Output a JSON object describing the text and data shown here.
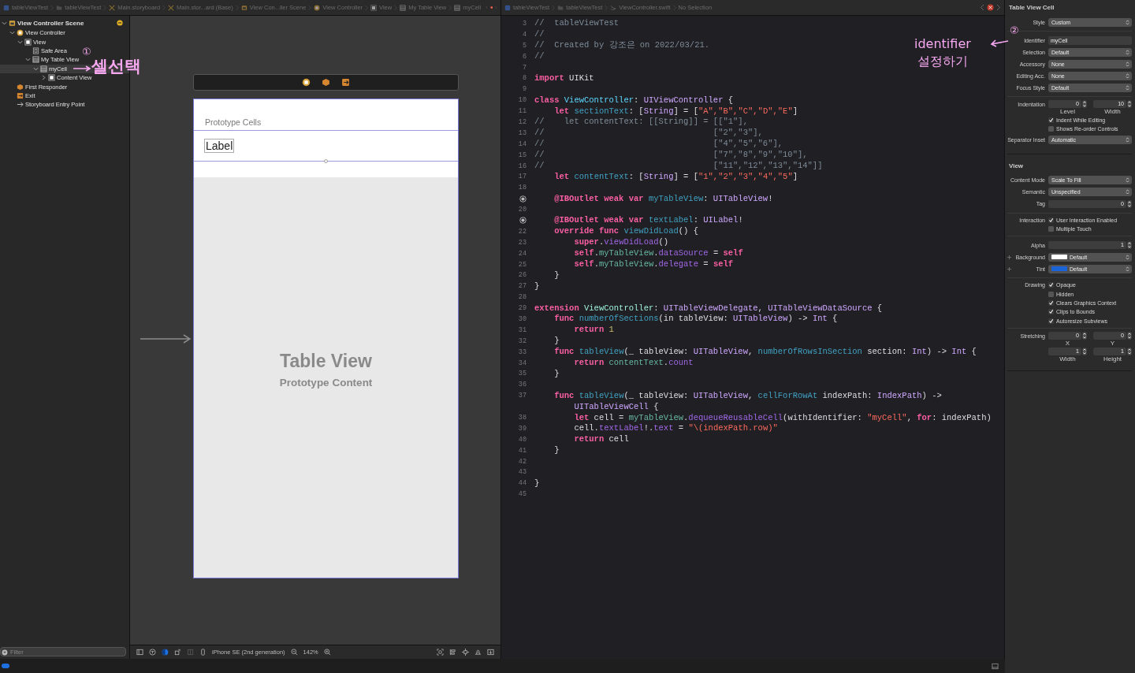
{
  "breadcrumbs_left": [
    {
      "kind": "project",
      "text": "tableViewTest"
    },
    {
      "kind": "folder",
      "text": "tableViewTest"
    },
    {
      "kind": "storyboard",
      "text": "Main.storyboard"
    },
    {
      "kind": "storyboard",
      "text": "Main.stor...ard (Base)"
    },
    {
      "kind": "scene",
      "text": "View Con...ller Scene"
    },
    {
      "kind": "vc",
      "text": "View Controller"
    },
    {
      "kind": "view",
      "text": "View"
    },
    {
      "kind": "table",
      "text": "My Table View"
    },
    {
      "kind": "table",
      "text": "myCell"
    }
  ],
  "breadcrumbs_right": [
    {
      "kind": "project",
      "text": "tableViewTest"
    },
    {
      "kind": "folder",
      "text": "tableViewTest"
    },
    {
      "kind": "swift",
      "text": "ViewController.swift"
    },
    {
      "kind": "none",
      "text": "No Selection"
    }
  ],
  "outline": {
    "items": [
      {
        "kind": "scene",
        "label": "View Controller Scene",
        "expanded": true,
        "selected": false,
        "children": [
          {
            "kind": "vc",
            "label": "View Controller",
            "expanded": true,
            "selected": false,
            "children": [
              {
                "kind": "view",
                "label": "View",
                "expanded": true,
                "selected": false,
                "children": [
                  {
                    "kind": "safearea",
                    "label": "Safe Area",
                    "selected": false
                  },
                  {
                    "kind": "table",
                    "label": "My Table View",
                    "expanded": true,
                    "selected": false,
                    "children": [
                      {
                        "kind": "table",
                        "label": "myCell",
                        "expanded": true,
                        "selected": true,
                        "children": [
                          {
                            "kind": "view",
                            "label": "Content View",
                            "expanded": false,
                            "selected": false
                          }
                        ]
                      }
                    ]
                  }
                ]
              }
            ]
          },
          {
            "kind": "responder",
            "label": "First Responder",
            "selected": false
          },
          {
            "kind": "exit",
            "label": "Exit",
            "selected": false
          },
          {
            "kind": "entry",
            "label": "Storyboard Entry Point",
            "selected": false
          }
        ]
      }
    ]
  },
  "filter": {
    "placeholder": "Filter"
  },
  "canvas": {
    "prototype_header": "Prototype Cells",
    "cell_label": "Label",
    "table_title": "Table View",
    "table_subtitle": "Prototype Content"
  },
  "canvas_toolbar": {
    "device": "iPhone SE (2nd generation)",
    "zoom": "142%"
  },
  "editor": {
    "lines": [
      {
        "kind": "line",
        "number": "3",
        "parts": [
          {
            "kind": "cmt",
            "text": "//  tableViewTest"
          }
        ]
      },
      {
        "kind": "line",
        "number": "4",
        "parts": [
          {
            "kind": "cmt",
            "text": "//"
          }
        ]
      },
      {
        "kind": "line",
        "number": "5",
        "parts": [
          {
            "kind": "cmt",
            "text": "//  Created by 강조은 on 2022/03/21."
          }
        ]
      },
      {
        "kind": "line",
        "number": "6",
        "parts": [
          {
            "kind": "cmt",
            "text": "//"
          }
        ]
      },
      {
        "kind": "line",
        "number": "7"
      },
      {
        "kind": "line",
        "number": "8",
        "parts": [
          {
            "kind": "kw",
            "text": "import"
          },
          {
            "kind": "plain",
            "text": " UIKit"
          }
        ]
      },
      {
        "kind": "line",
        "number": "9"
      },
      {
        "kind": "line",
        "number": "10",
        "parts": [
          {
            "kind": "kw",
            "text": "class "
          },
          {
            "kind": "decltype",
            "text": "ViewController"
          },
          {
            "kind": "plain",
            "text": ": "
          },
          {
            "kind": "type",
            "text": "UIViewController"
          },
          {
            "kind": "plain",
            "text": " {"
          }
        ]
      },
      {
        "kind": "line",
        "number": "11",
        "parts": [
          {
            "kind": "kw",
            "text": "    let "
          },
          {
            "kind": "decl",
            "text": "sectionText"
          },
          {
            "kind": "plain",
            "text": ": ["
          },
          {
            "kind": "type",
            "text": "String"
          },
          {
            "kind": "plain",
            "text": "] = ["
          },
          {
            "kind": "str",
            "text": "\"A\",\"B\",\"C\",\"D\",\"E\""
          },
          {
            "kind": "plain",
            "text": "]"
          }
        ]
      },
      {
        "kind": "line",
        "number": "12",
        "parts": [
          {
            "kind": "cmt",
            "text": "//    let contentText: [[String]] = [[\"1\"],"
          }
        ]
      },
      {
        "kind": "line",
        "number": "13",
        "parts": [
          {
            "kind": "cmt",
            "text": "//                                  [\"2\",\"3\"],"
          }
        ]
      },
      {
        "kind": "line",
        "number": "14",
        "parts": [
          {
            "kind": "cmt",
            "text": "//                                  [\"4\",\"5\",\"6\"],"
          }
        ]
      },
      {
        "kind": "line",
        "number": "15",
        "parts": [
          {
            "kind": "cmt",
            "text": "//                                  [\"7\",\"8\",\"9\",\"10\"],"
          }
        ]
      },
      {
        "kind": "line",
        "number": "16",
        "parts": [
          {
            "kind": "cmt",
            "text": "//                                  [\"11\",\"12\",\"13\",\"14\"]]"
          }
        ]
      },
      {
        "kind": "line",
        "number": "17",
        "parts": [
          {
            "kind": "kw",
            "text": "    let "
          },
          {
            "kind": "decl",
            "text": "contentText"
          },
          {
            "kind": "plain",
            "text": ": ["
          },
          {
            "kind": "type",
            "text": "String"
          },
          {
            "kind": "plain",
            "text": "] = ["
          },
          {
            "kind": "str",
            "text": "\"1\",\"2\",\"3\",\"4\",\"5\""
          },
          {
            "kind": "plain",
            "text": "]"
          }
        ]
      },
      {
        "kind": "line",
        "number": "18"
      },
      {
        "kind": "outlet",
        "parts": [
          {
            "kind": "kw",
            "text": "    @IBOutlet weak var "
          },
          {
            "kind": "decl",
            "text": "myTableView"
          },
          {
            "kind": "plain",
            "text": ": "
          },
          {
            "kind": "type",
            "text": "UITableView"
          },
          {
            "kind": "plain",
            "text": "!"
          }
        ]
      },
      {
        "kind": "line",
        "number": "20"
      },
      {
        "kind": "outlet",
        "parts": [
          {
            "kind": "kw",
            "text": "    @IBOutlet weak var "
          },
          {
            "kind": "decl",
            "text": "textLabel"
          },
          {
            "kind": "plain",
            "text": ": "
          },
          {
            "kind": "type",
            "text": "UILabel"
          },
          {
            "kind": "plain",
            "text": "!"
          }
        ]
      },
      {
        "kind": "line",
        "number": "22",
        "parts": [
          {
            "kind": "kw",
            "text": "    override func "
          },
          {
            "kind": "decl",
            "text": "viewDidLoad"
          },
          {
            "kind": "plain",
            "text": "() {"
          }
        ]
      },
      {
        "kind": "line",
        "number": "23",
        "parts": [
          {
            "kind": "kw",
            "text": "        super"
          },
          {
            "kind": "plain",
            "text": "."
          },
          {
            "kind": "other",
            "text": "viewDidLoad"
          },
          {
            "kind": "plain",
            "text": "()"
          }
        ]
      },
      {
        "kind": "line",
        "number": "24",
        "parts": [
          {
            "kind": "kw",
            "text": "        self"
          },
          {
            "kind": "plain",
            "text": "."
          },
          {
            "kind": "proj",
            "text": "myTableView"
          },
          {
            "kind": "plain",
            "text": "."
          },
          {
            "kind": "other",
            "text": "dataSource"
          },
          {
            "kind": "plain",
            "text": " = "
          },
          {
            "kind": "kw",
            "text": "self"
          }
        ]
      },
      {
        "kind": "line",
        "number": "25",
        "parts": [
          {
            "kind": "kw",
            "text": "        self"
          },
          {
            "kind": "plain",
            "text": "."
          },
          {
            "kind": "proj",
            "text": "myTableView"
          },
          {
            "kind": "plain",
            "text": "."
          },
          {
            "kind": "other",
            "text": "delegate"
          },
          {
            "kind": "plain",
            "text": " = "
          },
          {
            "kind": "kw",
            "text": "self"
          }
        ]
      },
      {
        "kind": "line",
        "number": "26",
        "parts": [
          {
            "kind": "plain",
            "text": "    }"
          }
        ]
      },
      {
        "kind": "line",
        "number": "27",
        "parts": [
          {
            "kind": "plain",
            "text": "}"
          }
        ]
      },
      {
        "kind": "line",
        "number": "28"
      },
      {
        "kind": "line",
        "number": "29",
        "parts": [
          {
            "kind": "kw",
            "text": "extension "
          },
          {
            "kind": "projtype",
            "text": "ViewController"
          },
          {
            "kind": "plain",
            "text": ": "
          },
          {
            "kind": "type",
            "text": "UITableViewDelegate"
          },
          {
            "kind": "plain",
            "text": ", "
          },
          {
            "kind": "type",
            "text": "UITableViewDataSource"
          },
          {
            "kind": "plain",
            "text": " {"
          }
        ]
      },
      {
        "kind": "line",
        "number": "30",
        "parts": [
          {
            "kind": "kw",
            "text": "    func "
          },
          {
            "kind": "decl",
            "text": "numberOfSections"
          },
          {
            "kind": "plain",
            "text": "(in tableView: "
          },
          {
            "kind": "type",
            "text": "UITableView"
          },
          {
            "kind": "plain",
            "text": ") -> "
          },
          {
            "kind": "type",
            "text": "Int"
          },
          {
            "kind": "plain",
            "text": " {"
          }
        ]
      },
      {
        "kind": "line",
        "number": "31",
        "parts": [
          {
            "kind": "kw",
            "text": "        return "
          },
          {
            "kind": "num",
            "text": "1"
          }
        ]
      },
      {
        "kind": "line",
        "number": "32",
        "parts": [
          {
            "kind": "plain",
            "text": "    }"
          }
        ]
      },
      {
        "kind": "line",
        "number": "33",
        "parts": [
          {
            "kind": "kw",
            "text": "    func "
          },
          {
            "kind": "decl",
            "text": "tableView"
          },
          {
            "kind": "plain",
            "text": "(_ tableView: "
          },
          {
            "kind": "type",
            "text": "UITableView"
          },
          {
            "kind": "plain",
            "text": ", "
          },
          {
            "kind": "decl",
            "text": "numberOfRowsInSection"
          },
          {
            "kind": "plain",
            "text": " section: "
          },
          {
            "kind": "type",
            "text": "Int"
          },
          {
            "kind": "plain",
            "text": ") -> "
          },
          {
            "kind": "type",
            "text": "Int"
          },
          {
            "kind": "plain",
            "text": " {"
          }
        ]
      },
      {
        "kind": "line",
        "number": "34",
        "parts": [
          {
            "kind": "kw",
            "text": "        return "
          },
          {
            "kind": "proj",
            "text": "contentText"
          },
          {
            "kind": "plain",
            "text": "."
          },
          {
            "kind": "other",
            "text": "count"
          }
        ]
      },
      {
        "kind": "line",
        "number": "35",
        "parts": [
          {
            "kind": "plain",
            "text": "    }"
          }
        ]
      },
      {
        "kind": "line",
        "number": "36"
      },
      {
        "kind": "line",
        "number": "37",
        "parts": [
          {
            "kind": "kw",
            "text": "    func "
          },
          {
            "kind": "decl",
            "text": "tableView"
          },
          {
            "kind": "plain",
            "text": "(_ tableView: "
          },
          {
            "kind": "type",
            "text": "UITableView"
          },
          {
            "kind": "plain",
            "text": ", "
          },
          {
            "kind": "decl",
            "text": "cellForRowAt"
          },
          {
            "kind": "plain",
            "text": " indexPath: "
          },
          {
            "kind": "type",
            "text": "IndexPath"
          },
          {
            "kind": "plain",
            "text": ") ->"
          }
        ]
      },
      {
        "kind": "wrap",
        "parts": [
          {
            "kind": "type",
            "text": "        UITableViewCell"
          },
          {
            "kind": "plain",
            "text": " {"
          }
        ]
      },
      {
        "kind": "line",
        "number": "38",
        "parts": [
          {
            "kind": "kw",
            "text": "        let"
          },
          {
            "kind": "plain",
            "text": " cell = "
          },
          {
            "kind": "proj",
            "text": "myTableView"
          },
          {
            "kind": "plain",
            "text": "."
          },
          {
            "kind": "other",
            "text": "dequeueReusableCell"
          },
          {
            "kind": "plain",
            "text": "(withIdentifier: "
          },
          {
            "kind": "str",
            "text": "\"myCell\""
          },
          {
            "kind": "plain",
            "text": ", "
          },
          {
            "kind": "kw",
            "text": "for"
          },
          {
            "kind": "plain",
            "text": ": indexPath)"
          }
        ]
      },
      {
        "kind": "line",
        "number": "39",
        "parts": [
          {
            "kind": "plain",
            "text": "        cell."
          },
          {
            "kind": "other",
            "text": "textLabel"
          },
          {
            "kind": "plain",
            "text": "!."
          },
          {
            "kind": "other",
            "text": "text"
          },
          {
            "kind": "plain",
            "text": " = "
          },
          {
            "kind": "str",
            "text": "\"\\(indexPath.row)\""
          }
        ]
      },
      {
        "kind": "line",
        "number": "40",
        "parts": [
          {
            "kind": "kw",
            "text": "        return"
          },
          {
            "kind": "plain",
            "text": " cell"
          }
        ]
      },
      {
        "kind": "line",
        "number": "41",
        "parts": [
          {
            "kind": "plain",
            "text": "    }"
          }
        ]
      },
      {
        "kind": "line",
        "number": "42"
      },
      {
        "kind": "line",
        "number": "43"
      },
      {
        "kind": "line",
        "number": "44",
        "parts": [
          {
            "kind": "plain",
            "text": "}"
          }
        ]
      },
      {
        "kind": "line",
        "number": "45"
      }
    ]
  },
  "inspector": {
    "sections": [
      {
        "title": "Table View Cell",
        "groups": [
          {
            "rows": [
              {
                "kind": "popup",
                "label": "Style",
                "value": "Custom"
              }
            ]
          },
          {
            "rows": [
              {
                "kind": "field",
                "label": "Identifier",
                "value": "myCell"
              },
              {
                "kind": "popup",
                "label": "Selection",
                "value": "Default"
              },
              {
                "kind": "popup",
                "label": "Accessory",
                "value": "None"
              },
              {
                "kind": "popup",
                "label": "Editing Acc.",
                "value": "None"
              },
              {
                "kind": "popup",
                "label": "Focus Style",
                "value": "Default"
              }
            ]
          },
          {
            "rows": [
              {
                "kind": "stepper2",
                "label": "Indentation",
                "values": [
                  {
                    "value": "0",
                    "caption": "Level"
                  },
                  {
                    "value": "10",
                    "caption": "Width"
                  }
                ]
              },
              {
                "kind": "check",
                "text": "Indent While Editing",
                "checked": true
              },
              {
                "kind": "check",
                "text": "Shows Re-order Controls",
                "checked": false
              },
              {
                "kind": "popup",
                "label": "Separator Inset",
                "value": "Automatic"
              }
            ]
          }
        ]
      },
      {
        "title": "View",
        "groups": [
          {
            "rows": [
              {
                "kind": "popup",
                "label": "Content Mode",
                "value": "Scale To Fill"
              },
              {
                "kind": "popup",
                "label": "Semantic",
                "value": "Unspecified"
              },
              {
                "kind": "stepper",
                "label": "Tag",
                "value": "0"
              }
            ]
          },
          {
            "rows": [
              {
                "kind": "check",
                "label": "Interaction",
                "text": "User Interaction Enabled",
                "checked": true
              },
              {
                "kind": "check",
                "text": "Multiple Touch",
                "checked": false
              }
            ]
          },
          {
            "rows": [
              {
                "kind": "stepper",
                "label": "Alpha",
                "value": "1"
              },
              {
                "kind": "color",
                "label": "Background",
                "value": "Default",
                "color": "#ffffff"
              },
              {
                "kind": "color",
                "label": "Tint",
                "value": "Default",
                "color": "#1a64d8"
              }
            ]
          },
          {
            "rows": [
              {
                "kind": "check",
                "label": "Drawing",
                "text": "Opaque",
                "checked": true
              },
              {
                "kind": "check",
                "text": "Hidden",
                "checked": false
              },
              {
                "kind": "check",
                "text": "Clears Graphics Context",
                "checked": true
              },
              {
                "kind": "check",
                "text": "Clips to Bounds",
                "checked": true
              },
              {
                "kind": "check",
                "text": "Autoresize Subviews",
                "checked": true
              }
            ]
          },
          {
            "rows": [
              {
                "kind": "stepper2",
                "label": "Stretching",
                "values": [
                  {
                    "value": "0",
                    "caption": "X"
                  },
                  {
                    "value": "0",
                    "caption": "Y"
                  }
                ]
              },
              {
                "kind": "stepper2",
                "values": [
                  {
                    "value": "1",
                    "caption": "Width"
                  },
                  {
                    "value": "1",
                    "caption": "Height"
                  }
                ]
              }
            ]
          }
        ]
      }
    ]
  },
  "annotations": [
    {
      "mark": "①",
      "text": "셀선택"
    },
    {
      "mark": "②",
      "text": "identifier 설정하기"
    }
  ]
}
